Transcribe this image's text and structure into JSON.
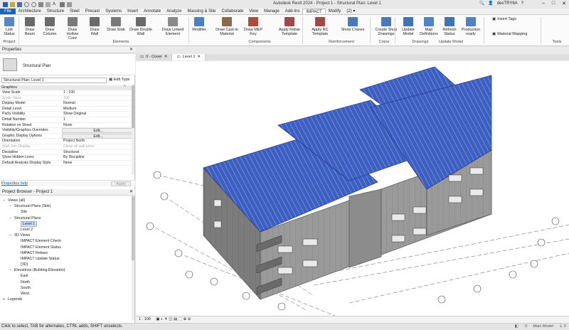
{
  "app": {
    "title": "Autodesk Revit 2024 - Project 1 - Structural Plan: Level 1",
    "user": "desTRY6A",
    "search_placeholder": "(2) ▾"
  },
  "tabs": [
    "File",
    "Architecture",
    "Structure",
    "Steel",
    "Precast",
    "Systems",
    "Insert",
    "Annotate",
    "Analyze",
    "Massing & Site",
    "Collaborate",
    "View",
    "Manage",
    "Add-Ins",
    "IMPACT",
    "Modify"
  ],
  "active_tab": "IMPACT",
  "ribbon": {
    "buttons": [
      "Link Status",
      "Draw Beam",
      "Draw Column",
      "Draw Hollow Core",
      "Draw Wall",
      "Draw Slab",
      "Draw Double Wall",
      "Draw Linked Element",
      "Modifier",
      "Draw Cast-in Material",
      "Draw MEP Key",
      "Apply Rebar Template",
      "Apply RC Template",
      "Show Cranes",
      "Create Shop Drawings",
      "Update Model",
      "Map Definitions",
      "Refresh Status",
      "Production ready"
    ],
    "small_buttons": [
      "Insert Tags",
      "Material Mapping"
    ],
    "groups": [
      "Project",
      "Elements",
      "Components",
      "Reinforcement",
      "Crane",
      "Drawings",
      "Update Model",
      "Tools"
    ]
  },
  "properties": {
    "header": "Properties",
    "type_name": "Structural Plan",
    "selector": "Structural Plan: Level 1",
    "edit_type": "Edit Type",
    "group": "Graphics",
    "rows": [
      {
        "k": "View Scale",
        "v": "1 : 100"
      },
      {
        "k": "Scale Value",
        "v": "100"
      },
      {
        "k": "Display Model",
        "v": "Normal"
      },
      {
        "k": "Detail Level",
        "v": "Medium"
      },
      {
        "k": "Parts Visibility",
        "v": "Show Original"
      },
      {
        "k": "Detail Number",
        "v": "1"
      },
      {
        "k": "Rotation on Sheet",
        "v": "None"
      },
      {
        "k": "Visibility/Graphics Overrides",
        "v": "Edit..."
      },
      {
        "k": "Graphic Display Options",
        "v": "Edit..."
      },
      {
        "k": "Orientation",
        "v": "Project North"
      },
      {
        "k": "Wall Join Display",
        "v": "Clean all wall joins"
      },
      {
        "k": "Discipline",
        "v": "Structural"
      },
      {
        "k": "Show Hidden Lines",
        "v": "By Discipline"
      },
      {
        "k": "Default Analysis Display Style",
        "v": "None"
      }
    ],
    "help": "Properties help",
    "apply": "Apply"
  },
  "browser": {
    "header": "Project Browser - Project 1",
    "items": [
      {
        "label": "Views (all)",
        "indent": 0,
        "tog": "−"
      },
      {
        "label": "Structural Plans (Site)",
        "indent": 1,
        "tog": "−"
      },
      {
        "label": "Site",
        "indent": 2,
        "tog": ""
      },
      {
        "label": "Structural Plans",
        "indent": 1,
        "tog": "−"
      },
      {
        "label": "Level 1",
        "indent": 2,
        "tog": "",
        "sel": true
      },
      {
        "label": "Level 2",
        "indent": 2,
        "tog": ""
      },
      {
        "label": "3D Views",
        "indent": 1,
        "tog": "−"
      },
      {
        "label": "IMPACT Element Check",
        "indent": 2,
        "tog": ""
      },
      {
        "label": "IMPACT Element Status",
        "indent": 2,
        "tog": ""
      },
      {
        "label": "IMPACT Rebars",
        "indent": 2,
        "tog": ""
      },
      {
        "label": "IMPACT Update Status",
        "indent": 2,
        "tog": ""
      },
      {
        "label": "{3D}",
        "indent": 2,
        "tog": ""
      },
      {
        "label": "Elevations (Building Elevation)",
        "indent": 1,
        "tog": "−"
      },
      {
        "label": "East",
        "indent": 2,
        "tog": ""
      },
      {
        "label": "North",
        "indent": 2,
        "tog": ""
      },
      {
        "label": "South",
        "indent": 2,
        "tog": ""
      },
      {
        "label": "West",
        "indent": 2,
        "tog": ""
      },
      {
        "label": "Legends",
        "indent": 0,
        "tog": "+"
      }
    ]
  },
  "view_tabs": [
    {
      "label": "0 - Cover",
      "active": false
    },
    {
      "label": "Level 1",
      "active": true
    }
  ],
  "view_scale": "1 : 100",
  "status": {
    "text": "Click to select, TAB for alternates, CTRL adds, SHIFT unselects.",
    "model": "Main Model",
    "zero": ":0"
  },
  "colors": {
    "file_tab": "#1e62b1",
    "roof": "#3d5fc2",
    "concrete": "#8a8a8a"
  }
}
